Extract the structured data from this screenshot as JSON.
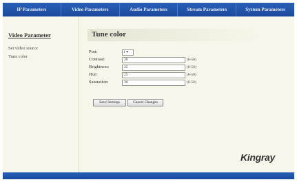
{
  "nav": {
    "tabs": [
      "IP Parameters",
      "Video Parameters",
      "Audio Parameters",
      "Stream Parameters",
      "System Parameters"
    ]
  },
  "sidebar": {
    "title": "Video Parameter",
    "items": [
      "Set video source",
      "Tune color"
    ]
  },
  "main": {
    "title": "Tune color",
    "port": {
      "label": "Port:",
      "value": "1"
    },
    "fields": [
      {
        "label": "Contrast:",
        "value": "20",
        "range": "(0-50)"
      },
      {
        "label": "Brightness:",
        "value": "25",
        "range": "(0-50)"
      },
      {
        "label": "Hue:",
        "value": "25",
        "range": "(0-50)"
      },
      {
        "label": "Saturation:",
        "value": "30",
        "range": "(0-50)"
      }
    ],
    "buttons": {
      "save": "Save Settings",
      "cancel": "Cancel Changes"
    }
  },
  "brand": {
    "logo": "Kingray"
  }
}
